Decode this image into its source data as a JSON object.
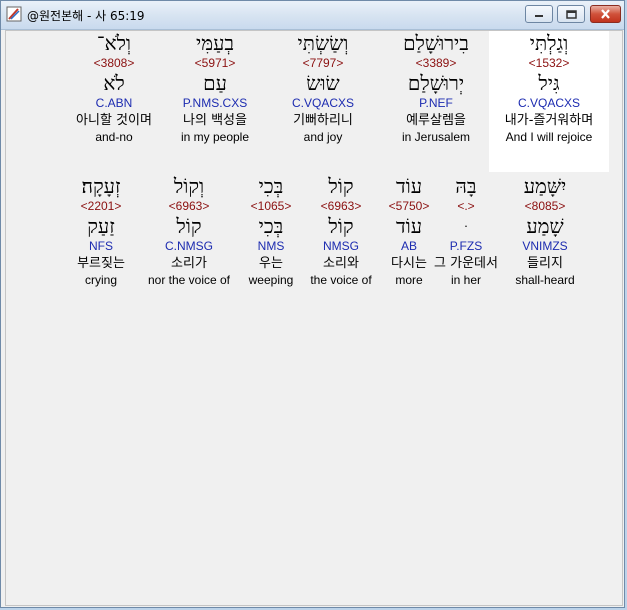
{
  "window": {
    "title": "@원전본해 - 사 65:19",
    "buttons": {
      "minimize_icon": "minimize-icon",
      "maximize_icon": "maximize-icon",
      "close_icon": "close-icon"
    }
  },
  "rows": [
    {
      "words": [
        {
          "hebrew": "וְגַלְתִּי",
          "strongs": "<1532>",
          "lemma": "גִּיל",
          "parsing": "C.VQACXS",
          "korean": "내가-즐거워하며",
          "english": "And I will rejoice",
          "highlighted": true
        },
        {
          "hebrew": "בִירוּשָׁלַם",
          "strongs": "<3389>",
          "lemma": "יְרוּשָׁלַם",
          "parsing": "P.NEF",
          "korean": "예루살렘을",
          "english": "in Jerusalem",
          "highlighted": false
        },
        {
          "hebrew": "וְשַׂשְׂתִּי",
          "strongs": "<7797>",
          "lemma": "שׂוּשׂ",
          "parsing": "C.VQACXS",
          "korean": "기뻐하리니",
          "english": "and joy",
          "highlighted": false
        },
        {
          "hebrew": "בְעַמִּי",
          "strongs": "<5971>",
          "lemma": "עַם",
          "parsing": "P.NMS.CXS",
          "korean": "나의 백성을",
          "english": "in my people",
          "highlighted": false
        },
        {
          "hebrew": "וְלֹא־",
          "strongs": "<3808>",
          "lemma": "לֹא",
          "parsing": "C.ABN",
          "korean": "아니할 것이며",
          "english": "and-no",
          "highlighted": false
        }
      ]
    },
    {
      "words": [
        {
          "hebrew": "יִשָּׁמַע",
          "strongs": "<8085>",
          "lemma": "שָׁמַע",
          "parsing": "VNIMZS",
          "korean": "들리지",
          "english": "shall-heard",
          "highlighted": false
        },
        {
          "hebrew": "בָּהּ",
          "strongs": "<.>",
          "lemma": "ּ",
          "parsing": "P.FZS",
          "korean": "그 가운데서",
          "english": "in her",
          "highlighted": false
        },
        {
          "hebrew": "עוֹד",
          "strongs": "<5750>",
          "lemma": "עוֹד",
          "parsing": "AB",
          "korean": "다시는",
          "english": "more",
          "highlighted": false
        },
        {
          "hebrew": "קוֹל",
          "strongs": "<6963>",
          "lemma": "קוֹל",
          "parsing": "NMSG",
          "korean": "소리와",
          "english": "the voice of",
          "highlighted": false
        },
        {
          "hebrew": "בְּכִי",
          "strongs": "<1065>",
          "lemma": "בְּכִי",
          "parsing": "NMS",
          "korean": "우는",
          "english": "weeping",
          "highlighted": false
        },
        {
          "hebrew": "וְקוֹל",
          "strongs": "<6963>",
          "lemma": "קוֹל",
          "parsing": "C.NMSG",
          "korean": "소리가",
          "english": "nor the voice of",
          "highlighted": false
        },
        {
          "hebrew": "זְעָקָה׃",
          "strongs": "<2201>",
          "lemma": "זַעַק",
          "parsing": "NFS",
          "korean": "부르짖는",
          "english": "crying",
          "highlighted": false
        }
      ]
    }
  ]
}
